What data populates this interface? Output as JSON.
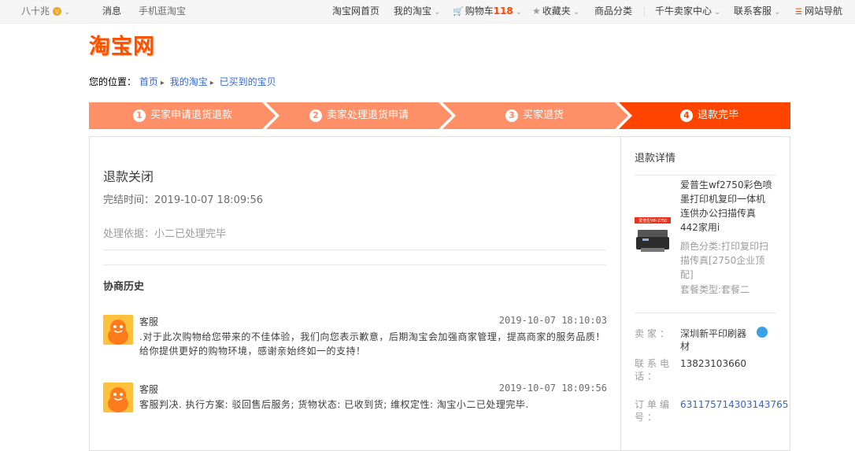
{
  "topbar": {
    "user": "八十兆",
    "coin": "v",
    "messages": "消息",
    "mobile": "手机逛淘宝",
    "home": "淘宝网首页",
    "my_taobao": "我的淘宝",
    "cart_label": "购物车",
    "cart_count": "118",
    "favorites": "收藏夹",
    "categories": "商品分类",
    "seller_center": "千牛卖家中心",
    "service": "联系客服",
    "site_nav": "网站导航"
  },
  "logo": "淘宝网",
  "breadcrumb": {
    "label": "您的位置：",
    "items": [
      "首页",
      "我的淘宝",
      "已买到的宝贝"
    ]
  },
  "steps": [
    {
      "num": "1",
      "label": "买家申请退货退款"
    },
    {
      "num": "2",
      "label": "卖家处理退货申请"
    },
    {
      "num": "3",
      "label": "买家退货"
    },
    {
      "num": "4",
      "label": "退款完毕"
    }
  ],
  "active_step": 4,
  "colors": {
    "step_inactive": "#ff8f66",
    "step_active": "#ff4400",
    "brand": "#ff5000"
  },
  "status": {
    "title": "退款关闭",
    "finish_time": "完结时间：2019-10-07 18:09:56",
    "basis": "处理依据：小二已处理完毕"
  },
  "history": {
    "title": "协商历史",
    "messages": [
      {
        "sender": "客服",
        "time": "2019-10-07 18:10:03",
        "text": ".对于此次购物给您带来的不佳体验，我们向您表示歉意，后期淘宝会加强商家管理，提高商家的服务品质！给你提供更好的购物环境，感谢亲始终如一的支持！"
      },
      {
        "sender": "客服",
        "time": "2019-10-07 18:09:56",
        "text": "客服判决. 执行方案: 驳回售后服务; 货物状态: 已收到货; 维权定性: 淘宝小二已处理完毕."
      }
    ]
  },
  "side": {
    "title": "退款详情",
    "product_name": "爱普生wf2750彩色喷墨打印机复印一体机连供办公扫描传真442家用i",
    "product_spec": "颜色分类:打印复印扫描传真[2750企业顶配]",
    "product_pkg": "套餐类型:套餐二",
    "product_img_text": "爱普生WF-2750",
    "seller_key": "卖家：",
    "seller_val": "深圳新平印刷器材",
    "phone_key": "联系电话：",
    "phone_val": "13823103660",
    "order_key": "订单编号：",
    "order_val": "631175714303143765"
  }
}
